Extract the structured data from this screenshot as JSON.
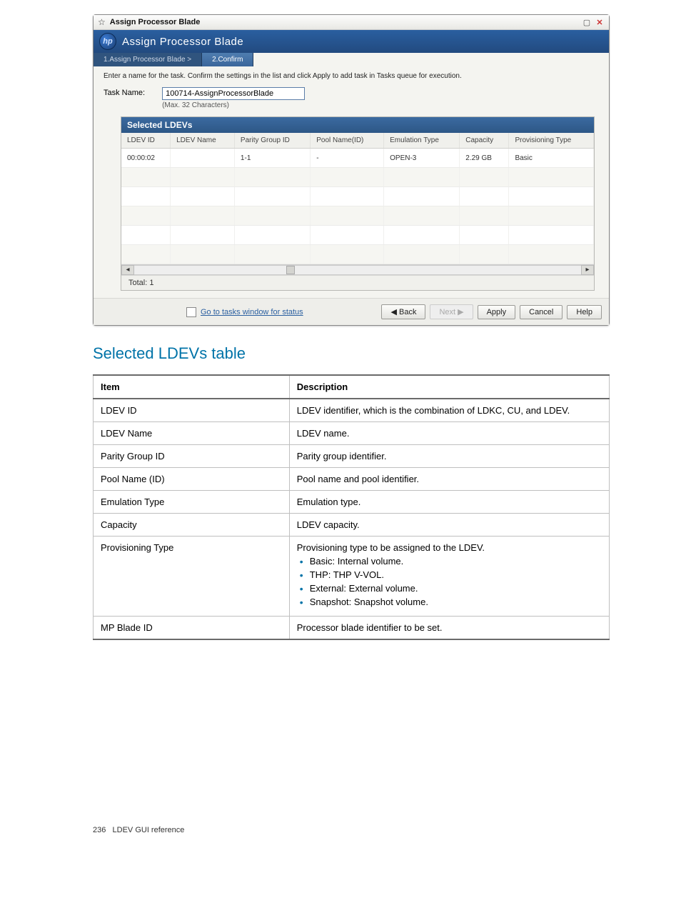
{
  "wizard": {
    "window_title": "Assign Processor Blade",
    "header_title": "Assign Processor Blade",
    "logo_text": "hp",
    "steps": {
      "step1": "1.Assign Processor Blade >",
      "step2": "2.Confirm"
    },
    "instruction": "Enter a name for the task. Confirm the settings in the list and click Apply to add task in Tasks queue for execution.",
    "task_name_label": "Task Name:",
    "task_name_value": "100714-AssignProcessorBlade",
    "task_name_hint": "(Max. 32 Characters)",
    "table_title": "Selected LDEVs",
    "columns": {
      "ldev_id": "LDEV ID",
      "ldev_name": "LDEV Name",
      "parity_group_id": "Parity Group ID",
      "pool_name_id": "Pool Name(ID)",
      "emulation_type": "Emulation Type",
      "capacity": "Capacity",
      "provisioning_type": "Provisioning Type"
    },
    "rows": [
      {
        "ldev_id": "00:00:02",
        "ldev_name": "",
        "parity_group_id": "1-1",
        "pool_name_id": "-",
        "emulation_type": "OPEN-3",
        "capacity": "2.29 GB",
        "provisioning_type": "Basic"
      }
    ],
    "total_label": "Total: 1",
    "go_to_tasks_label": "Go to tasks window for status",
    "buttons": {
      "back": "◀ Back",
      "next": "Next ▶",
      "apply": "Apply",
      "cancel": "Cancel",
      "help": "Help"
    }
  },
  "section_title": "Selected LDEVs table",
  "desc_table": {
    "header_item": "Item",
    "header_desc": "Description",
    "rows": [
      {
        "item": "LDEV ID",
        "desc": "LDEV identifier, which is the combination of LDKC, CU, and LDEV."
      },
      {
        "item": "LDEV Name",
        "desc": "LDEV name."
      },
      {
        "item": "Parity Group ID",
        "desc": "Parity group identifier."
      },
      {
        "item": "Pool Name (ID)",
        "desc": "Pool name and pool identifier."
      },
      {
        "item": "Emulation Type",
        "desc": "Emulation type."
      },
      {
        "item": "Capacity",
        "desc": "LDEV capacity."
      },
      {
        "item": "Provisioning Type",
        "desc": "Provisioning type to be assigned to the LDEV.",
        "bullets": [
          "Basic: Internal volume.",
          "THP: THP V-VOL.",
          "External: External volume.",
          "Snapshot: Snapshot volume."
        ]
      },
      {
        "item": "MP Blade ID",
        "desc": "Processor blade identifier to be set."
      }
    ]
  },
  "footer": {
    "page_number": "236",
    "section": "LDEV GUI reference"
  }
}
